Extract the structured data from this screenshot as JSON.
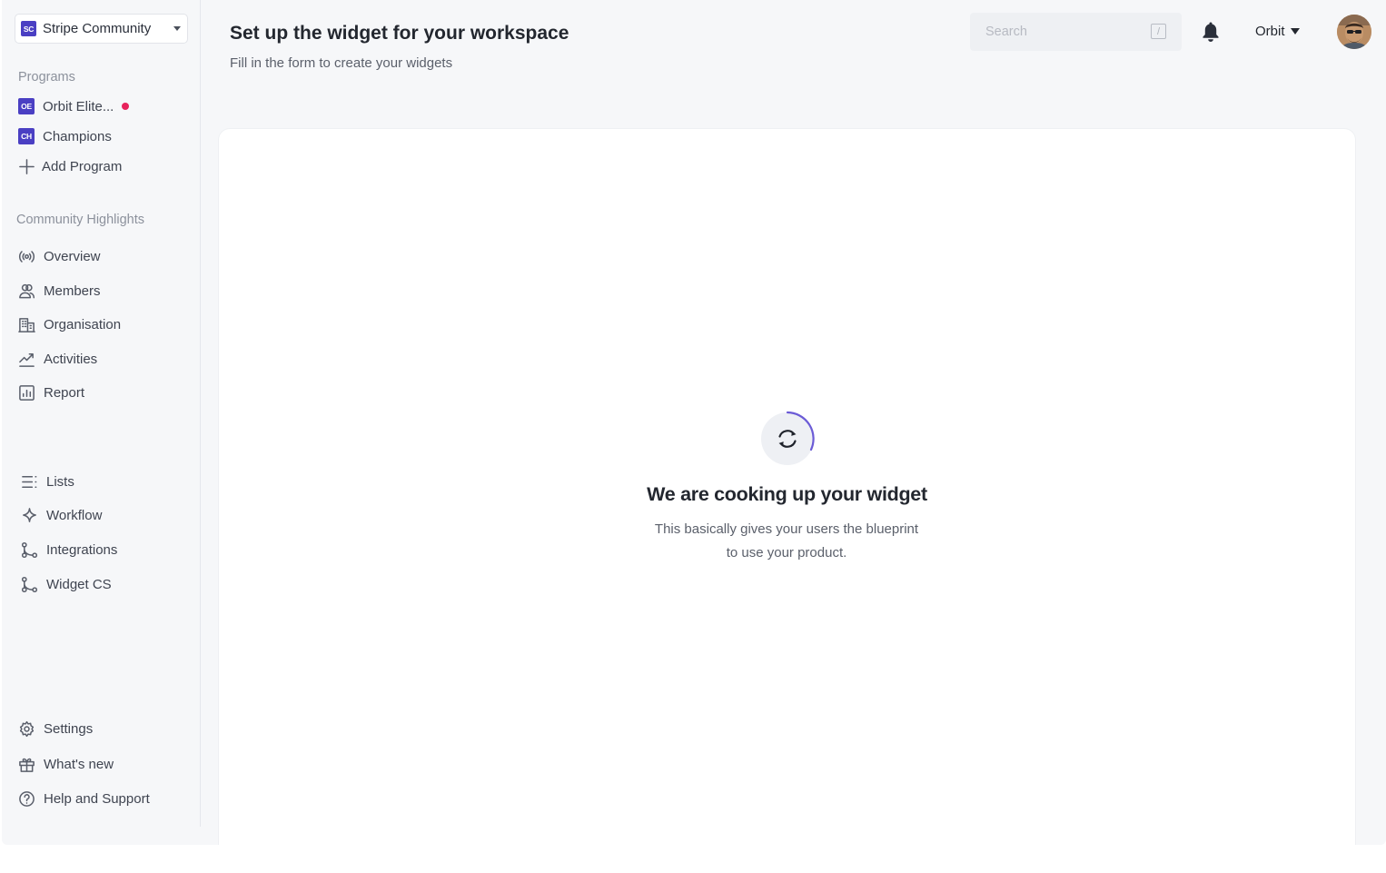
{
  "workspace": {
    "badge": "SC",
    "name": "Stripe Community"
  },
  "programs": {
    "section_label": "Programs",
    "items": [
      {
        "badge": "OE",
        "label": "Orbit Elite...",
        "has_notification": true
      },
      {
        "badge": "CH",
        "label": "Champions",
        "has_notification": false
      }
    ],
    "add_label": "Add Program"
  },
  "highlights": {
    "section_label": "Community Highlights",
    "items": [
      {
        "label": "Overview",
        "icon": "broadcast-icon"
      },
      {
        "label": "Members",
        "icon": "members-icon"
      },
      {
        "label": "Organisation",
        "icon": "building-icon"
      },
      {
        "label": "Activities",
        "icon": "trend-chart-icon"
      },
      {
        "label": "Report",
        "icon": "bar-chart-icon"
      }
    ]
  },
  "tools": {
    "items": [
      {
        "label": "Lists",
        "icon": "list-icon"
      },
      {
        "label": "Workflow",
        "icon": "sparkle-icon"
      },
      {
        "label": "Integrations",
        "icon": "git-branch-icon"
      },
      {
        "label": "Widget CS",
        "icon": "git-branch-icon"
      }
    ]
  },
  "footer": {
    "items": [
      {
        "label": "Settings",
        "icon": "gear-icon"
      },
      {
        "label": "What's new",
        "icon": "gift-icon"
      },
      {
        "label": "Help and Support",
        "icon": "help-circle-icon"
      }
    ]
  },
  "header": {
    "title": "Set up the widget for your workspace",
    "subtitle": "Fill in the form to create your widgets",
    "search_placeholder": "Search",
    "search_shortcut": "/",
    "user_label": "Orbit"
  },
  "main": {
    "loading_title": "We are cooking up your widget",
    "loading_description": "This basically gives your users the blueprint to use your product."
  },
  "colors": {
    "accent": "#4a3fc3",
    "notification": "#e7235c",
    "spinner": "#6b5bd6"
  }
}
